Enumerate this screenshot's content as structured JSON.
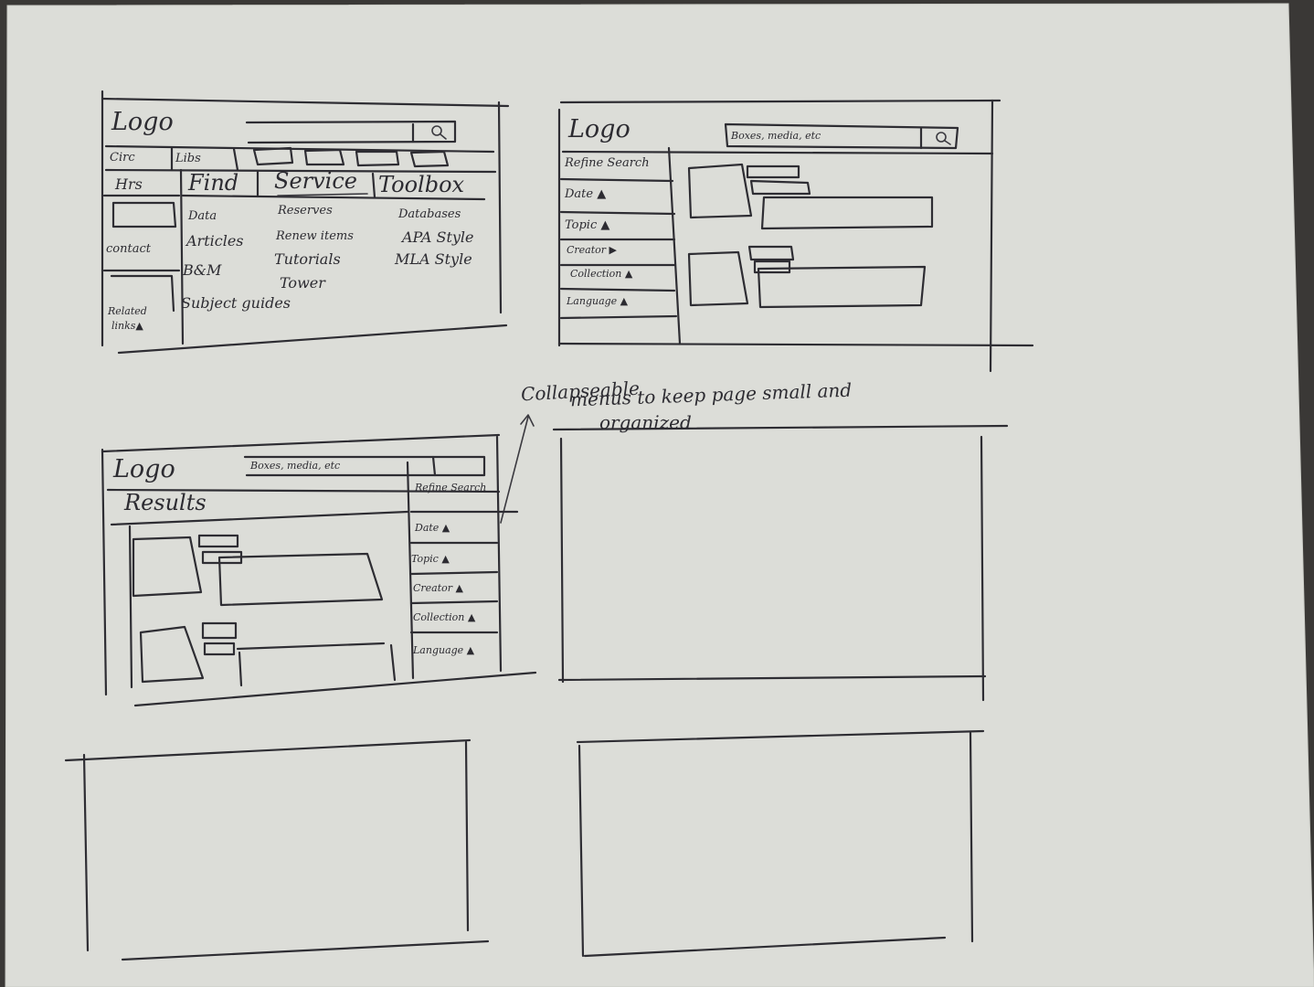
{
  "panels": {
    "home": {
      "logo": "Logo",
      "nav_tabs": [
        "Circ",
        "Libs"
      ],
      "sidebar": {
        "hours": "Hrs",
        "contact": "contact",
        "related_links": "Related",
        "links": "links▲"
      },
      "columns": {
        "find": {
          "heading": "Find",
          "items": [
            "Data",
            "Articles",
            "B&M",
            "Subject guides"
          ]
        },
        "service": {
          "heading": "Service",
          "items": [
            "Reserves",
            "Renew items",
            "Tutorials",
            "Tower"
          ]
        },
        "toolbox": {
          "heading": "Toolbox",
          "items": [
            "Databases",
            "APA Style",
            "MLA Style"
          ]
        }
      }
    },
    "search": {
      "logo": "Logo",
      "search_value": "Boxes, media, etc",
      "refine_heading": "Refine Search",
      "filters": [
        "Date ▲",
        "Topic ▲",
        "Creator ▶",
        "Collection ▲",
        "Language ▲"
      ]
    },
    "results": {
      "logo": "Logo",
      "search_value": "Boxes, media, etc",
      "results_heading": "Results",
      "refine_heading": "Refine Search",
      "filters": [
        "Date ▲",
        "Topic ▲",
        "Creator ▲",
        "Collection ▲",
        "Language ▲"
      ]
    }
  },
  "annotation": {
    "line1": "Collapseable",
    "line2": "menus to keep page small and",
    "line3": "organized"
  }
}
